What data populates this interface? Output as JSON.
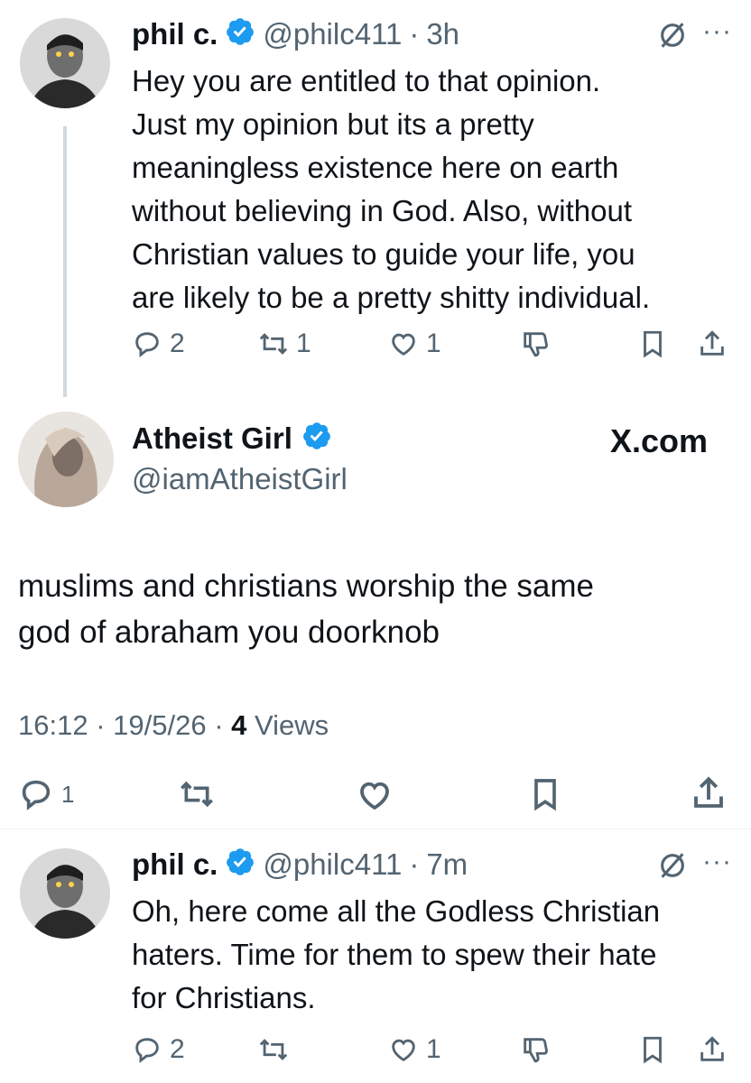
{
  "tweet1": {
    "name": "phil c.",
    "handle": "@philc411",
    "time": "3h",
    "lines": "Hey you are entitled to that opinion.\nJust my opinion but its a pretty\nmeaningless existence here on earth\nwithout believing in God. Also, without\nChristian values to guide your life, you\nare likely to be a pretty shitty individual.",
    "replies": "2",
    "reposts": "1",
    "likes": "1"
  },
  "main_tweet": {
    "name": "Atheist Girl",
    "handle": "@iamAtheistGirl",
    "brand": "X.com",
    "text": "muslims and christians worship the same\ngod of abraham you doorknob",
    "time": "16:12",
    "date": "19/5/26",
    "views_count": "4",
    "views_label": "Views",
    "replies": "1"
  },
  "tweet3": {
    "name": "phil c.",
    "handle": "@philc411",
    "time": "7m",
    "lines": "Oh, here come all the Godless Christian\nhaters. Time for them to spew their hate\nfor Christians.",
    "replies": "2",
    "likes": "1"
  },
  "colors": {
    "accent": "#1d9bf0",
    "muted": "#536471",
    "text": "#0f1419"
  }
}
